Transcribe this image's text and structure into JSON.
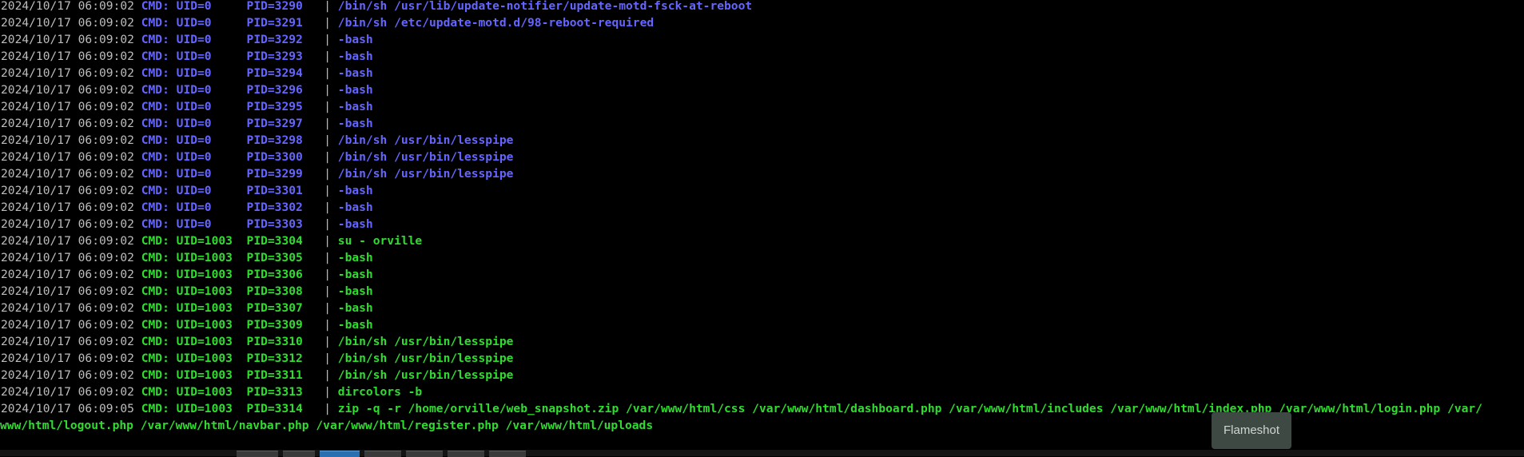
{
  "terminal": {
    "lines": [
      {
        "ts": "2024/10/17 06:09:02",
        "uid": "CMD: UID=0     PID=3290",
        "cmd": "/bin/sh /usr/lib/update-notifier/update-motd-fsck-at-reboot",
        "kind": "root"
      },
      {
        "ts": "2024/10/17 06:09:02",
        "uid": "CMD: UID=0     PID=3291",
        "cmd": "/bin/sh /etc/update-motd.d/98-reboot-required",
        "kind": "root"
      },
      {
        "ts": "2024/10/17 06:09:02",
        "uid": "CMD: UID=0     PID=3292",
        "cmd": "-bash",
        "kind": "root"
      },
      {
        "ts": "2024/10/17 06:09:02",
        "uid": "CMD: UID=0     PID=3293",
        "cmd": "-bash",
        "kind": "root"
      },
      {
        "ts": "2024/10/17 06:09:02",
        "uid": "CMD: UID=0     PID=3294",
        "cmd": "-bash",
        "kind": "root"
      },
      {
        "ts": "2024/10/17 06:09:02",
        "uid": "CMD: UID=0     PID=3296",
        "cmd": "-bash",
        "kind": "root"
      },
      {
        "ts": "2024/10/17 06:09:02",
        "uid": "CMD: UID=0     PID=3295",
        "cmd": "-bash",
        "kind": "root"
      },
      {
        "ts": "2024/10/17 06:09:02",
        "uid": "CMD: UID=0     PID=3297",
        "cmd": "-bash",
        "kind": "root"
      },
      {
        "ts": "2024/10/17 06:09:02",
        "uid": "CMD: UID=0     PID=3298",
        "cmd": "/bin/sh /usr/bin/lesspipe",
        "kind": "root"
      },
      {
        "ts": "2024/10/17 06:09:02",
        "uid": "CMD: UID=0     PID=3300",
        "cmd": "/bin/sh /usr/bin/lesspipe",
        "kind": "root"
      },
      {
        "ts": "2024/10/17 06:09:02",
        "uid": "CMD: UID=0     PID=3299",
        "cmd": "/bin/sh /usr/bin/lesspipe",
        "kind": "root"
      },
      {
        "ts": "2024/10/17 06:09:02",
        "uid": "CMD: UID=0     PID=3301",
        "cmd": "-bash",
        "kind": "root"
      },
      {
        "ts": "2024/10/17 06:09:02",
        "uid": "CMD: UID=0     PID=3302",
        "cmd": "-bash",
        "kind": "root"
      },
      {
        "ts": "2024/10/17 06:09:02",
        "uid": "CMD: UID=0     PID=3303",
        "cmd": "-bash",
        "kind": "root"
      },
      {
        "ts": "2024/10/17 06:09:02",
        "uid": "CMD: UID=1003  PID=3304",
        "cmd": "su - orville",
        "kind": "user"
      },
      {
        "ts": "2024/10/17 06:09:02",
        "uid": "CMD: UID=1003  PID=3305",
        "cmd": "-bash",
        "kind": "user"
      },
      {
        "ts": "2024/10/17 06:09:02",
        "uid": "CMD: UID=1003  PID=3306",
        "cmd": "-bash",
        "kind": "user"
      },
      {
        "ts": "2024/10/17 06:09:02",
        "uid": "CMD: UID=1003  PID=3308",
        "cmd": "-bash",
        "kind": "user"
      },
      {
        "ts": "2024/10/17 06:09:02",
        "uid": "CMD: UID=1003  PID=3307",
        "cmd": "-bash",
        "kind": "user"
      },
      {
        "ts": "2024/10/17 06:09:02",
        "uid": "CMD: UID=1003  PID=3309",
        "cmd": "-bash",
        "kind": "user"
      },
      {
        "ts": "2024/10/17 06:09:02",
        "uid": "CMD: UID=1003  PID=3310",
        "cmd": "/bin/sh /usr/bin/lesspipe",
        "kind": "user"
      },
      {
        "ts": "2024/10/17 06:09:02",
        "uid": "CMD: UID=1003  PID=3312",
        "cmd": "/bin/sh /usr/bin/lesspipe",
        "kind": "user"
      },
      {
        "ts": "2024/10/17 06:09:02",
        "uid": "CMD: UID=1003  PID=3311",
        "cmd": "/bin/sh /usr/bin/lesspipe",
        "kind": "user"
      },
      {
        "ts": "2024/10/17 06:09:02",
        "uid": "CMD: UID=1003  PID=3313",
        "cmd": "dircolors -b",
        "kind": "user"
      },
      {
        "ts": "2024/10/17 06:09:05",
        "uid": "CMD: UID=1003  PID=3314",
        "cmd": "zip -q -r /home/orville/web_snapshot.zip /var/www/html/css /var/www/html/dashboard.php /var/www/html/includes /var/www/html/index.php /var/www/html/login.php /var/",
        "kind": "user"
      }
    ],
    "wrap_line": "www/html/logout.php /var/www/html/navbar.php /var/www/html/register.php /var/www/html/uploads",
    "separator": "|",
    "colors": {
      "timestamp": "#bdbdbd",
      "root": "#6565ff",
      "user": "#2fdc2f",
      "background": "#000000"
    }
  },
  "flameshot": {
    "label": "Flameshot"
  }
}
